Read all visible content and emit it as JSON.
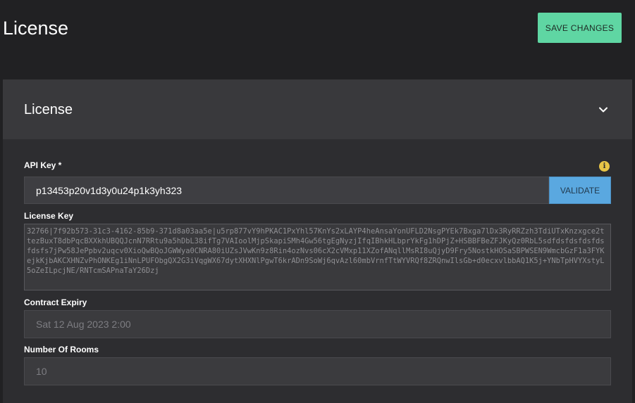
{
  "header": {
    "title": "License",
    "save_label": "SAVE CHANGES"
  },
  "panel": {
    "title": "License",
    "api_key": {
      "label": "API Key *",
      "value": "p13453p20v1d3y0u24p1k3yh323",
      "validate_label": "VALIDATE",
      "info_glyph": "i"
    },
    "license_key": {
      "label": "License Key",
      "value": "32766|7f92b573-31c3-4162-85b9-371d8a03aa5e|u5rp877vY9hPKAC1PxYhl57KnYs2xLAYP4heAnsaYonUFLD2NsgPYEk7Bxga7lDx3RyRRZzh3TdiUTxKnzxgce2ttezBuxT8dbPqcBXXkhUBQQJcnN7RRtu9a5hDbL38ifTg7VAIoolMjpSkapiSMh4Gw56tgEgNyzjIfqIBhkHLbprYkFg1hDPjZ+HSBBFBeZFJKyQz0RbL5sdfdsfdsfdsfdsfdsfs7jPw58JePpbv2uqcv0XioQwBQoJGWWya0CNRA80iUZsJVwKn9z8Rin4ozNvs06cX2cVMxp11XZofANqllMsRI8uQjyD9Fry5NostkHOSaSBPWSEN9WmcbGzF1a3FYKejkKjbAKCXHNZvPhONKEg1iNnLPUFObgQX2G3iVqgWX67dytXHXNlPgwT6krADn9SoWj6qvAzl60mbVrnfTtWYVRQf8ZRQnwIlsGb+d0ecxvlbbAQ1K5j+YNbTpHVYXstyL5oZeILpcjNE/RNTcmSAPnaTaY26Dzj"
    },
    "contract_expiry": {
      "label": "Contract Expiry",
      "value": "Sat 12 Aug 2023 2:00"
    },
    "number_of_rooms": {
      "label": "Number Of Rooms",
      "value": "10"
    }
  },
  "colors": {
    "background": "#212123",
    "panel": "#2d2d30",
    "panel_header": "#39393c",
    "save_button": "#5fd6a3",
    "validate_button": "#5aa8e0",
    "info_icon": "#e8c547"
  },
  "icons": {
    "collapse": "chevron-down-icon",
    "info": "info-icon"
  }
}
